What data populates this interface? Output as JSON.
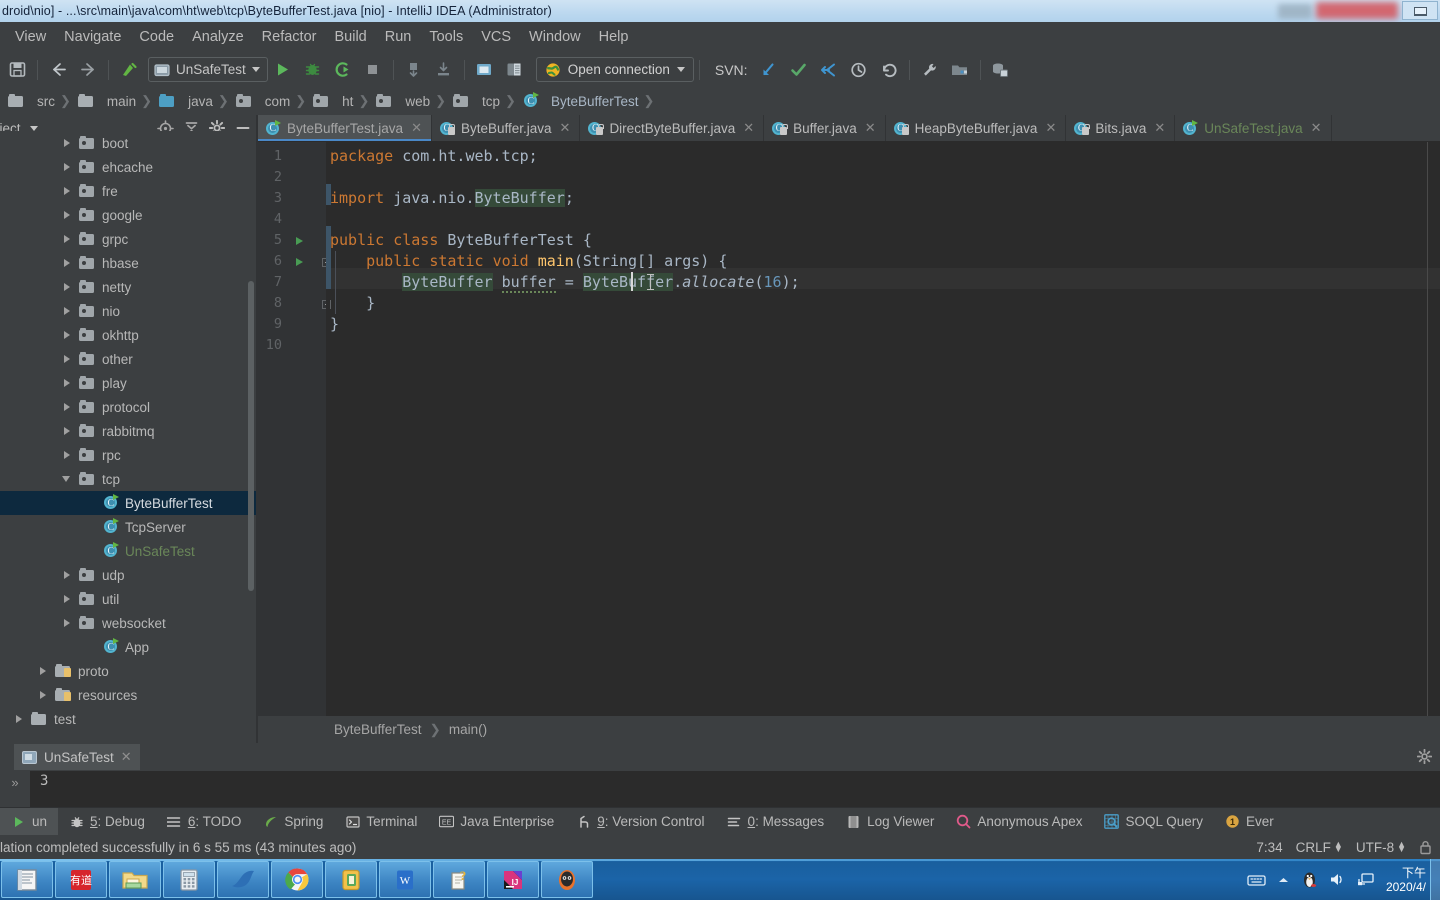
{
  "window": {
    "title": "droid\\nio] - ...\\src\\main\\java\\com\\ht\\web\\tcp\\ByteBufferTest.java [nio] - IntelliJ IDEA (Administrator)"
  },
  "menubar": {
    "items": [
      "View",
      "Navigate",
      "Code",
      "Analyze",
      "Refactor",
      "Build",
      "Run",
      "Tools",
      "VCS",
      "Window",
      "Help"
    ]
  },
  "toolbar": {
    "run_config": "UnSafeTest",
    "open_connection": "Open connection",
    "svn_label": "SVN:"
  },
  "breadcrumb": {
    "items": [
      "src",
      "main",
      "java",
      "com",
      "ht",
      "web",
      "tcp",
      "ByteBufferTest"
    ]
  },
  "project_panel": {
    "title": "oject",
    "tree": [
      {
        "label": "boot",
        "indent": 2,
        "arrow": "closed",
        "icon": "folder",
        "style": "normal",
        "selected": false
      },
      {
        "label": "ehcache",
        "indent": 2,
        "arrow": "closed",
        "icon": "folder",
        "style": "normal",
        "selected": false
      },
      {
        "label": "fre",
        "indent": 2,
        "arrow": "closed",
        "icon": "folder",
        "style": "normal",
        "selected": false
      },
      {
        "label": "google",
        "indent": 2,
        "arrow": "closed",
        "icon": "folder",
        "style": "normal",
        "selected": false
      },
      {
        "label": "grpc",
        "indent": 2,
        "arrow": "closed",
        "icon": "folder",
        "style": "normal",
        "selected": false
      },
      {
        "label": "hbase",
        "indent": 2,
        "arrow": "closed",
        "icon": "folder",
        "style": "normal",
        "selected": false
      },
      {
        "label": "netty",
        "indent": 2,
        "arrow": "closed",
        "icon": "folder",
        "style": "normal",
        "selected": false
      },
      {
        "label": "nio",
        "indent": 2,
        "arrow": "closed",
        "icon": "folder",
        "style": "normal",
        "selected": false
      },
      {
        "label": "okhttp",
        "indent": 2,
        "arrow": "closed",
        "icon": "folder",
        "style": "normal",
        "selected": false
      },
      {
        "label": "other",
        "indent": 2,
        "arrow": "closed",
        "icon": "folder",
        "style": "normal",
        "selected": false
      },
      {
        "label": "play",
        "indent": 2,
        "arrow": "closed",
        "icon": "folder",
        "style": "normal",
        "selected": false
      },
      {
        "label": "protocol",
        "indent": 2,
        "arrow": "closed",
        "icon": "folder",
        "style": "normal",
        "selected": false
      },
      {
        "label": "rabbitmq",
        "indent": 2,
        "arrow": "closed",
        "icon": "folder",
        "style": "normal",
        "selected": false
      },
      {
        "label": "rpc",
        "indent": 2,
        "arrow": "closed",
        "icon": "folder",
        "style": "normal",
        "selected": false
      },
      {
        "label": "tcp",
        "indent": 2,
        "arrow": "open",
        "icon": "folder",
        "style": "normal",
        "selected": false
      },
      {
        "label": "ByteBufferTest",
        "indent": 3,
        "arrow": "none",
        "icon": "class",
        "style": "selected",
        "selected": true
      },
      {
        "label": "TcpServer",
        "indent": 3,
        "arrow": "none",
        "icon": "class",
        "style": "normal",
        "selected": false
      },
      {
        "label": "UnSafeTest",
        "indent": 3,
        "arrow": "none",
        "icon": "class",
        "style": "green",
        "selected": false
      },
      {
        "label": "udp",
        "indent": 2,
        "arrow": "closed",
        "icon": "folder",
        "style": "normal",
        "selected": false
      },
      {
        "label": "util",
        "indent": 2,
        "arrow": "closed",
        "icon": "folder",
        "style": "normal",
        "selected": false
      },
      {
        "label": "websocket",
        "indent": 2,
        "arrow": "closed",
        "icon": "folder",
        "style": "normal",
        "selected": false
      },
      {
        "label": "App",
        "indent": 3,
        "arrow": "none",
        "icon": "classrun",
        "style": "normal",
        "selected": false
      },
      {
        "label": "proto",
        "indent": 1,
        "arrow": "closed",
        "icon": "folderres",
        "style": "normal",
        "selected": false
      },
      {
        "label": "resources",
        "indent": 1,
        "arrow": "closed",
        "icon": "folderres",
        "style": "normal",
        "selected": false
      },
      {
        "label": "test",
        "indent": 0,
        "arrow": "closed",
        "icon": "folderplain",
        "style": "normal",
        "selected": false
      }
    ]
  },
  "editor": {
    "tabs": [
      {
        "label": "ByteBufferTest.java",
        "active": true,
        "icon": "class-run",
        "style": "dim"
      },
      {
        "label": "ByteBuffer.java",
        "active": false,
        "icon": "class-lock",
        "style": "normal"
      },
      {
        "label": "DirectByteBuffer.java",
        "active": false,
        "icon": "class-lock",
        "style": "normal"
      },
      {
        "label": "Buffer.java",
        "active": false,
        "icon": "class-lock",
        "style": "normal"
      },
      {
        "label": "HeapByteBuffer.java",
        "active": false,
        "icon": "class-lock",
        "style": "normal"
      },
      {
        "label": "Bits.java",
        "active": false,
        "icon": "class-lock",
        "style": "normal"
      },
      {
        "label": "UnSafeTest.java",
        "active": false,
        "icon": "class-run",
        "style": "green"
      }
    ],
    "line_numbers": [
      "1",
      "2",
      "3",
      "4",
      "5",
      "6",
      "7",
      "8",
      "9",
      "10"
    ],
    "code_lines": [
      "package com.ht.web.tcp;",
      "",
      "import java.nio.ByteBuffer;",
      "",
      "public class ByteBufferTest {",
      "    public static void main(String[] args) {",
      "        ByteBuffer buffer = ByteBuffer.allocate(16);",
      "    }",
      "}",
      ""
    ],
    "breadcrumb_class": "ByteBufferTest",
    "breadcrumb_method": "main()"
  },
  "run_window": {
    "tab_label": "UnSafeTest",
    "console_output": "3"
  },
  "tool_windows": [
    {
      "label": "un",
      "icon": "run-icon",
      "active": true,
      "underline": ""
    },
    {
      "label": "5: Debug",
      "icon": "bug-icon",
      "active": false,
      "underline": "5"
    },
    {
      "label": "6: TODO",
      "icon": "list-icon",
      "active": false,
      "underline": "6"
    },
    {
      "label": "Spring",
      "icon": "spring-leaf-icon",
      "active": false,
      "underline": ""
    },
    {
      "label": "Terminal",
      "icon": "terminal-icon",
      "active": false,
      "underline": ""
    },
    {
      "label": "Java Enterprise",
      "icon": "ee-icon",
      "active": false,
      "underline": ""
    },
    {
      "label": "9: Version Control",
      "icon": "branch-icon",
      "active": false,
      "underline": "9"
    },
    {
      "label": "0: Messages",
      "icon": "messages-icon",
      "active": false,
      "underline": "0"
    },
    {
      "label": "Log Viewer",
      "icon": "log-icon",
      "active": false,
      "underline": ""
    },
    {
      "label": "Anonymous Apex",
      "icon": "apex-icon",
      "active": false,
      "underline": ""
    },
    {
      "label": "SOQL Query",
      "icon": "soql-icon",
      "active": false,
      "underline": ""
    },
    {
      "label": "Ever",
      "icon": "event-badge-icon",
      "active": false,
      "underline": ""
    }
  ],
  "status_bar": {
    "message": "lation completed successfully in 6 s 55 ms (43 minutes ago)",
    "caret_position": "7:34",
    "line_separator": "CRLF",
    "encoding": "UTF-8"
  },
  "taskbar": {
    "items": [
      "notepad-icon",
      "youdao-icon",
      "explorer-icon",
      "calculator-icon",
      "wireshark-icon",
      "chrome-icon",
      "evernote-icon",
      "wps-icon",
      "help-icon",
      "intellij-icon",
      "app-icon"
    ],
    "tray": [
      "keyboard-icon",
      "chevron-up-icon",
      "penguin-icon",
      "volume-icon",
      "network-icon"
    ],
    "clock_period": "下午",
    "clock_date": "2020/4/"
  },
  "colors": {
    "accent": "#4a88c7",
    "keyword": "#cc7832",
    "string": "#6a8759",
    "number": "#6897bb",
    "selection": "#0d293e",
    "editor_bg": "#2b2b2b",
    "panel_bg": "#3c3f41"
  }
}
